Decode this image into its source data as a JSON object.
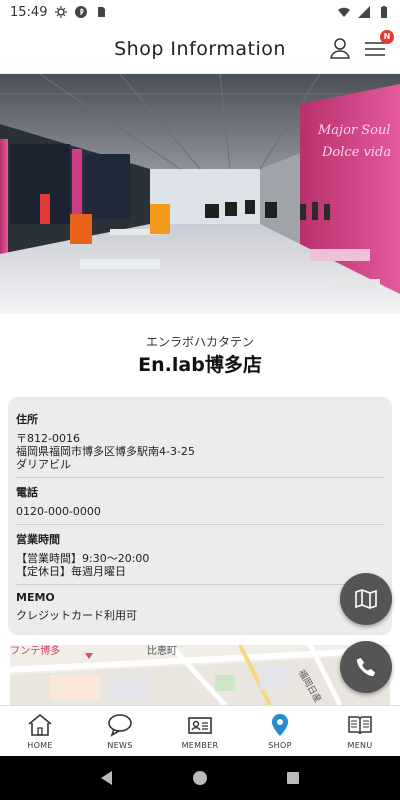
{
  "status_bar": {
    "time": "15:49"
  },
  "header": {
    "title": "Shop Information",
    "badge": "N"
  },
  "shop": {
    "kana": "エンラボハカタテン",
    "name": "En.lab博多店"
  },
  "info": [
    {
      "label": "住所",
      "lines": [
        "〒812-0016",
        "福岡県福岡市博多区博多駅南4-3-25",
        "ダリアビル"
      ]
    },
    {
      "label": "電話",
      "lines": [
        "0120-000-0000"
      ]
    },
    {
      "label": "営業時間",
      "lines": [
        "【営業時間】9:30～20:00",
        "【定休日】毎週月曜日"
      ]
    },
    {
      "label": "MEMO",
      "lines": [
        "クレジットカード利用可"
      ]
    }
  ],
  "map": {
    "labels": [
      "フンテ博多",
      "比恵町",
      "福岡日産"
    ]
  },
  "tabs": [
    {
      "label": "HOME",
      "icon": "home-icon"
    },
    {
      "label": "NEWS",
      "icon": "chat-bubble-icon"
    },
    {
      "label": "MEMBER",
      "icon": "member-card-icon"
    },
    {
      "label": "SHOP",
      "icon": "location-pin-icon"
    },
    {
      "label": "MENU",
      "icon": "book-icon"
    }
  ],
  "colors": {
    "accent": "#2b8bd1",
    "fab": "#555555",
    "badge": "#e53935",
    "card": "#ececec"
  }
}
